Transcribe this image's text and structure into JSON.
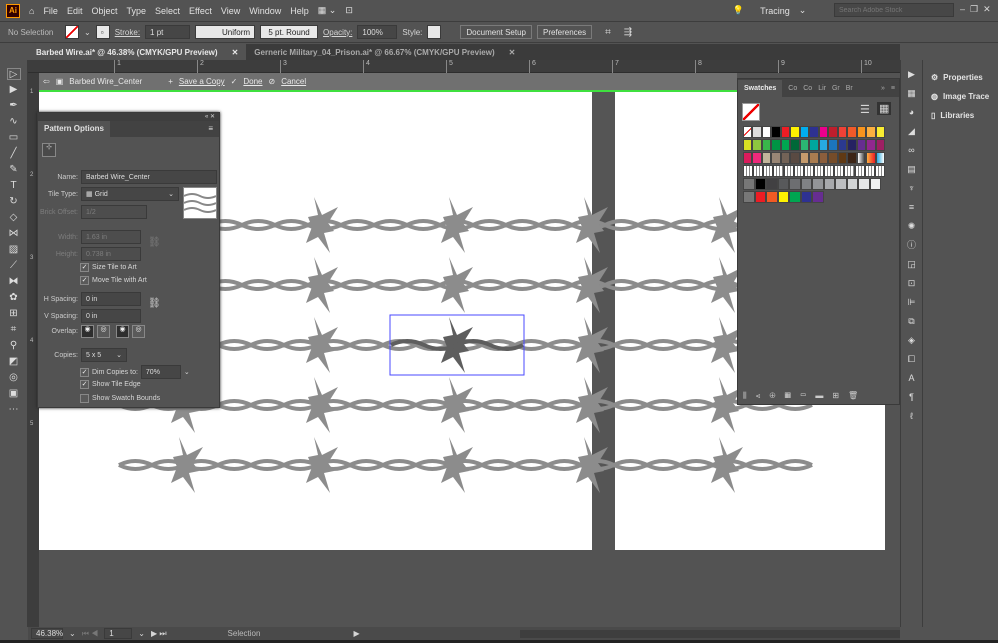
{
  "menu": {
    "logo": "Ai",
    "items": [
      "File",
      "Edit",
      "Object",
      "Type",
      "Select",
      "Effect",
      "View",
      "Window",
      "Help"
    ],
    "workspace": "Tracing",
    "search_placeholder": "Search Adobe Stock"
  },
  "control": {
    "selection": "No Selection",
    "stroke_label": "Stroke:",
    "stroke_value": "1 pt",
    "profile": "Uniform",
    "brush": "5 pt. Round",
    "opacity_label": "Opacity:",
    "opacity": "100%",
    "style_label": "Style:",
    "document_setup": "Document Setup",
    "preferences": "Preferences"
  },
  "tabs": [
    {
      "label": "Barbed Wire.ai* @ 46.38% (CMYK/GPU Preview)",
      "active": true
    },
    {
      "label": "Gerneric Military_04_Prison.ai* @ 66.67% (CMYK/GPU Preview)",
      "active": false
    }
  ],
  "ruler": {
    "ticks": [
      "1",
      "2",
      "3",
      "4",
      "5",
      "6",
      "7",
      "8",
      "9",
      "10"
    ],
    "vticks": [
      "1",
      "2",
      "3",
      "4",
      "5"
    ]
  },
  "pattern_bar": {
    "name": "Barbed Wire_Center",
    "save": "Save a Copy",
    "done": "Done",
    "cancel": "Cancel"
  },
  "pattern_options": {
    "title": "Pattern Options",
    "name_label": "Name:",
    "name": "Barbed Wire_Center",
    "tile_type_label": "Tile Type:",
    "tile_type": "Grid",
    "brick_offset_label": "Brick Offset:",
    "brick_offset": "1/2",
    "width_label": "Width:",
    "width": "1.63 in",
    "height_label": "Height:",
    "height": "0.738 in",
    "size_tile": "Size Tile to Art",
    "move_tile": "Move Tile with Art",
    "h_spacing_label": "H Spacing:",
    "h_spacing": "0 in",
    "v_spacing_label": "V Spacing:",
    "v_spacing": "0 in",
    "overlap_label": "Overlap:",
    "copies_label": "Copies:",
    "copies": "5 x 5",
    "dim_label": "Dim Copies to:",
    "dim": "70%",
    "show_edge": "Show Tile Edge",
    "show_bounds": "Show Swatch Bounds",
    "checks": {
      "size_tile": true,
      "move_tile": true,
      "dim": true,
      "show_edge": true,
      "show_bounds": false
    }
  },
  "swatches": {
    "tabs": [
      "Swatches",
      "Co",
      "Co",
      "Lir",
      "Gr",
      "Br"
    ],
    "rows": [
      [
        "none",
        "reg",
        "#ffffff",
        "#000000",
        "#ed1c24",
        "#fff200",
        "#00aeef",
        "#2e3192",
        "#ec008c",
        "#be1e2d",
        "#ef4136",
        "#f15a29",
        "#f7941d",
        "#fbb040",
        "#f9ed32"
      ],
      [
        "#d7df23",
        "#8dc63f",
        "#39b54a",
        "#009444",
        "#00a651",
        "#006838",
        "#2bb673",
        "#00a79d",
        "#27aae1",
        "#1c75bc",
        "#2b3990",
        "#262262",
        "#662d91",
        "#92278f",
        "#9e1f63"
      ],
      [
        "#da1c5c",
        "#ee2a7b",
        "#c2b59b",
        "#998675",
        "#736357",
        "#594a42",
        "#c49a6c",
        "#a97c50",
        "#8b5e3c",
        "#754c29",
        "#603913",
        "#3c2415",
        "grad1",
        "grad2",
        "grad3"
      ],
      [
        "pat",
        "pat",
        "pat",
        "pat",
        "pat",
        "pat",
        "pat",
        "pat",
        "pat",
        "pat",
        "pat",
        "pat",
        "pat",
        "pat"
      ],
      [
        "folder",
        "#000000",
        "#414042",
        "#58595b",
        "#6d6e71",
        "#808285",
        "#939598",
        "#a7a9ac",
        "#bcbec0",
        "#d1d3d4",
        "#e6e7e8",
        "#f1f2f2"
      ],
      [
        "folder",
        "#ed1c24",
        "#f15a24",
        "#fff200",
        "#00a651",
        "#2e3192",
        "#662d91"
      ]
    ]
  },
  "properties": {
    "items": [
      "Properties",
      "Image Trace",
      "Libraries"
    ]
  },
  "status": {
    "zoom": "46.38%",
    "artboard": "1",
    "tool": "Selection"
  },
  "colors": {
    "selection": "#4848ff",
    "wire": "#8c8c8c",
    "wire_center": "#5e5e5e",
    "tile_edge_green": "#3fe03f"
  }
}
